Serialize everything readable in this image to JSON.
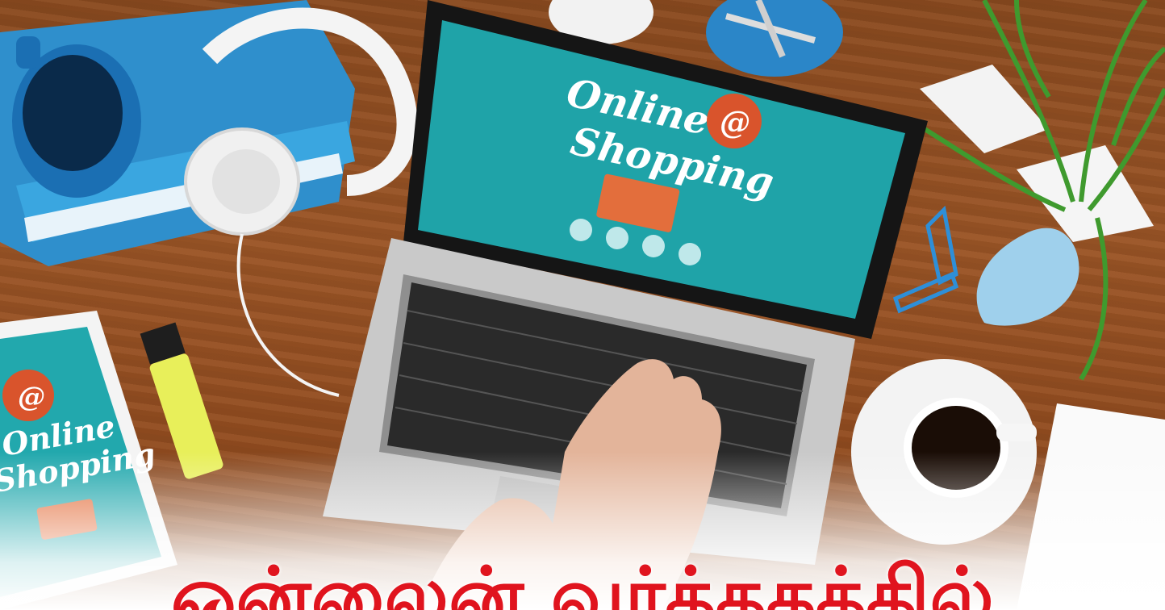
{
  "laptop_screen": {
    "line1": "Online",
    "line2": "Shopping",
    "badge_glyph": "@"
  },
  "tablet_screen": {
    "line1": "Online",
    "line2": "Shopping",
    "badge_glyph": "@"
  },
  "headline": {
    "text": "ஒன்லைன் வர்த்தகத்தில்"
  },
  "colors": {
    "headline": "#e0141e",
    "screen_teal": "#1fa3a8",
    "badge": "#d9542c"
  }
}
